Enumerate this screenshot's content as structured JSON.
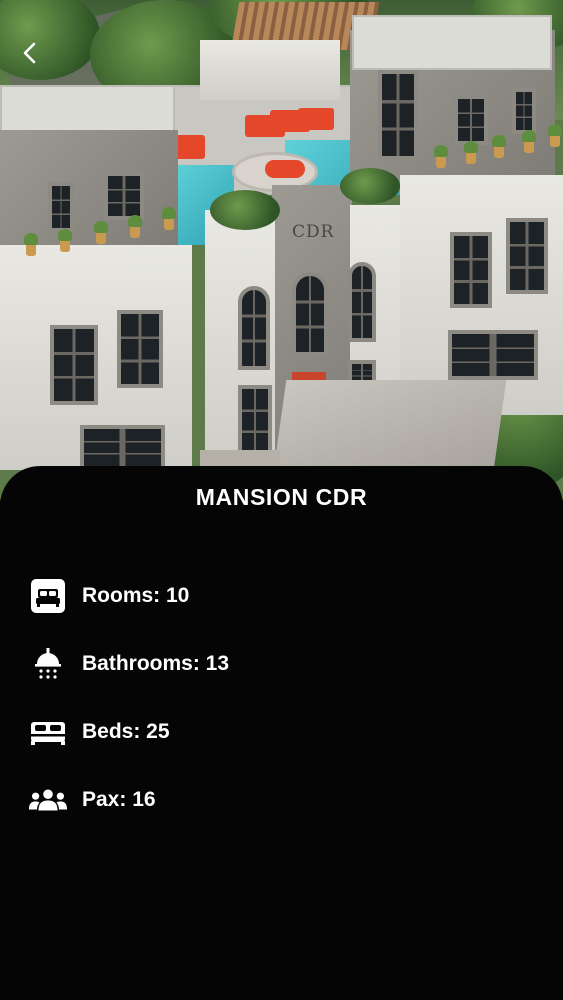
{
  "property": {
    "title": "MANSION CDR",
    "facade_sign": "CDR"
  },
  "navigation": {
    "back_icon": "chevron-left-icon"
  },
  "specs": [
    {
      "icon": "bedroom-icon",
      "label": "Rooms: 10"
    },
    {
      "icon": "shower-icon",
      "label": "Bathrooms: 13"
    },
    {
      "icon": "bed-icon",
      "label": "Beds: 25"
    },
    {
      "icon": "people-icon",
      "label": "Pax: 16"
    }
  ],
  "colors": {
    "background": "#050505",
    "text": "#ffffff"
  }
}
